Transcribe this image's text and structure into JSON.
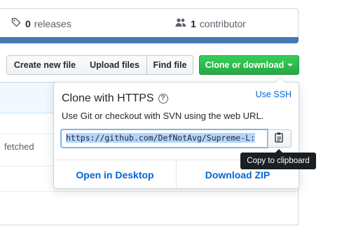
{
  "summary": {
    "releases": {
      "count": "0",
      "label": "releases",
      "icon": "tag-icon"
    },
    "contributors": {
      "count": "1",
      "label": "contributor",
      "icon": "people-icon"
    }
  },
  "language_bar_color": "#4578b4",
  "toolbar": {
    "create_label": "Create new file",
    "upload_label": "Upload files",
    "find_label": "Find file",
    "clone_label": "Clone or download"
  },
  "background": {
    "fetched_text": "fetched"
  },
  "clone_dropdown": {
    "title": "Clone with HTTPS",
    "help_icon": "question-icon",
    "use_ssh_label": "Use SSH",
    "description": "Use Git or checkout with SVN using the web URL.",
    "url": "https://github.com/DefNotAvg/Supreme-L:",
    "copy_icon": "clipboard-icon",
    "open_desktop_label": "Open in Desktop",
    "download_zip_label": "Download ZIP"
  },
  "tooltip": {
    "text": "Copy to clipboard"
  },
  "colors": {
    "accent_green": "#28a745",
    "link_blue": "#0366d6"
  }
}
